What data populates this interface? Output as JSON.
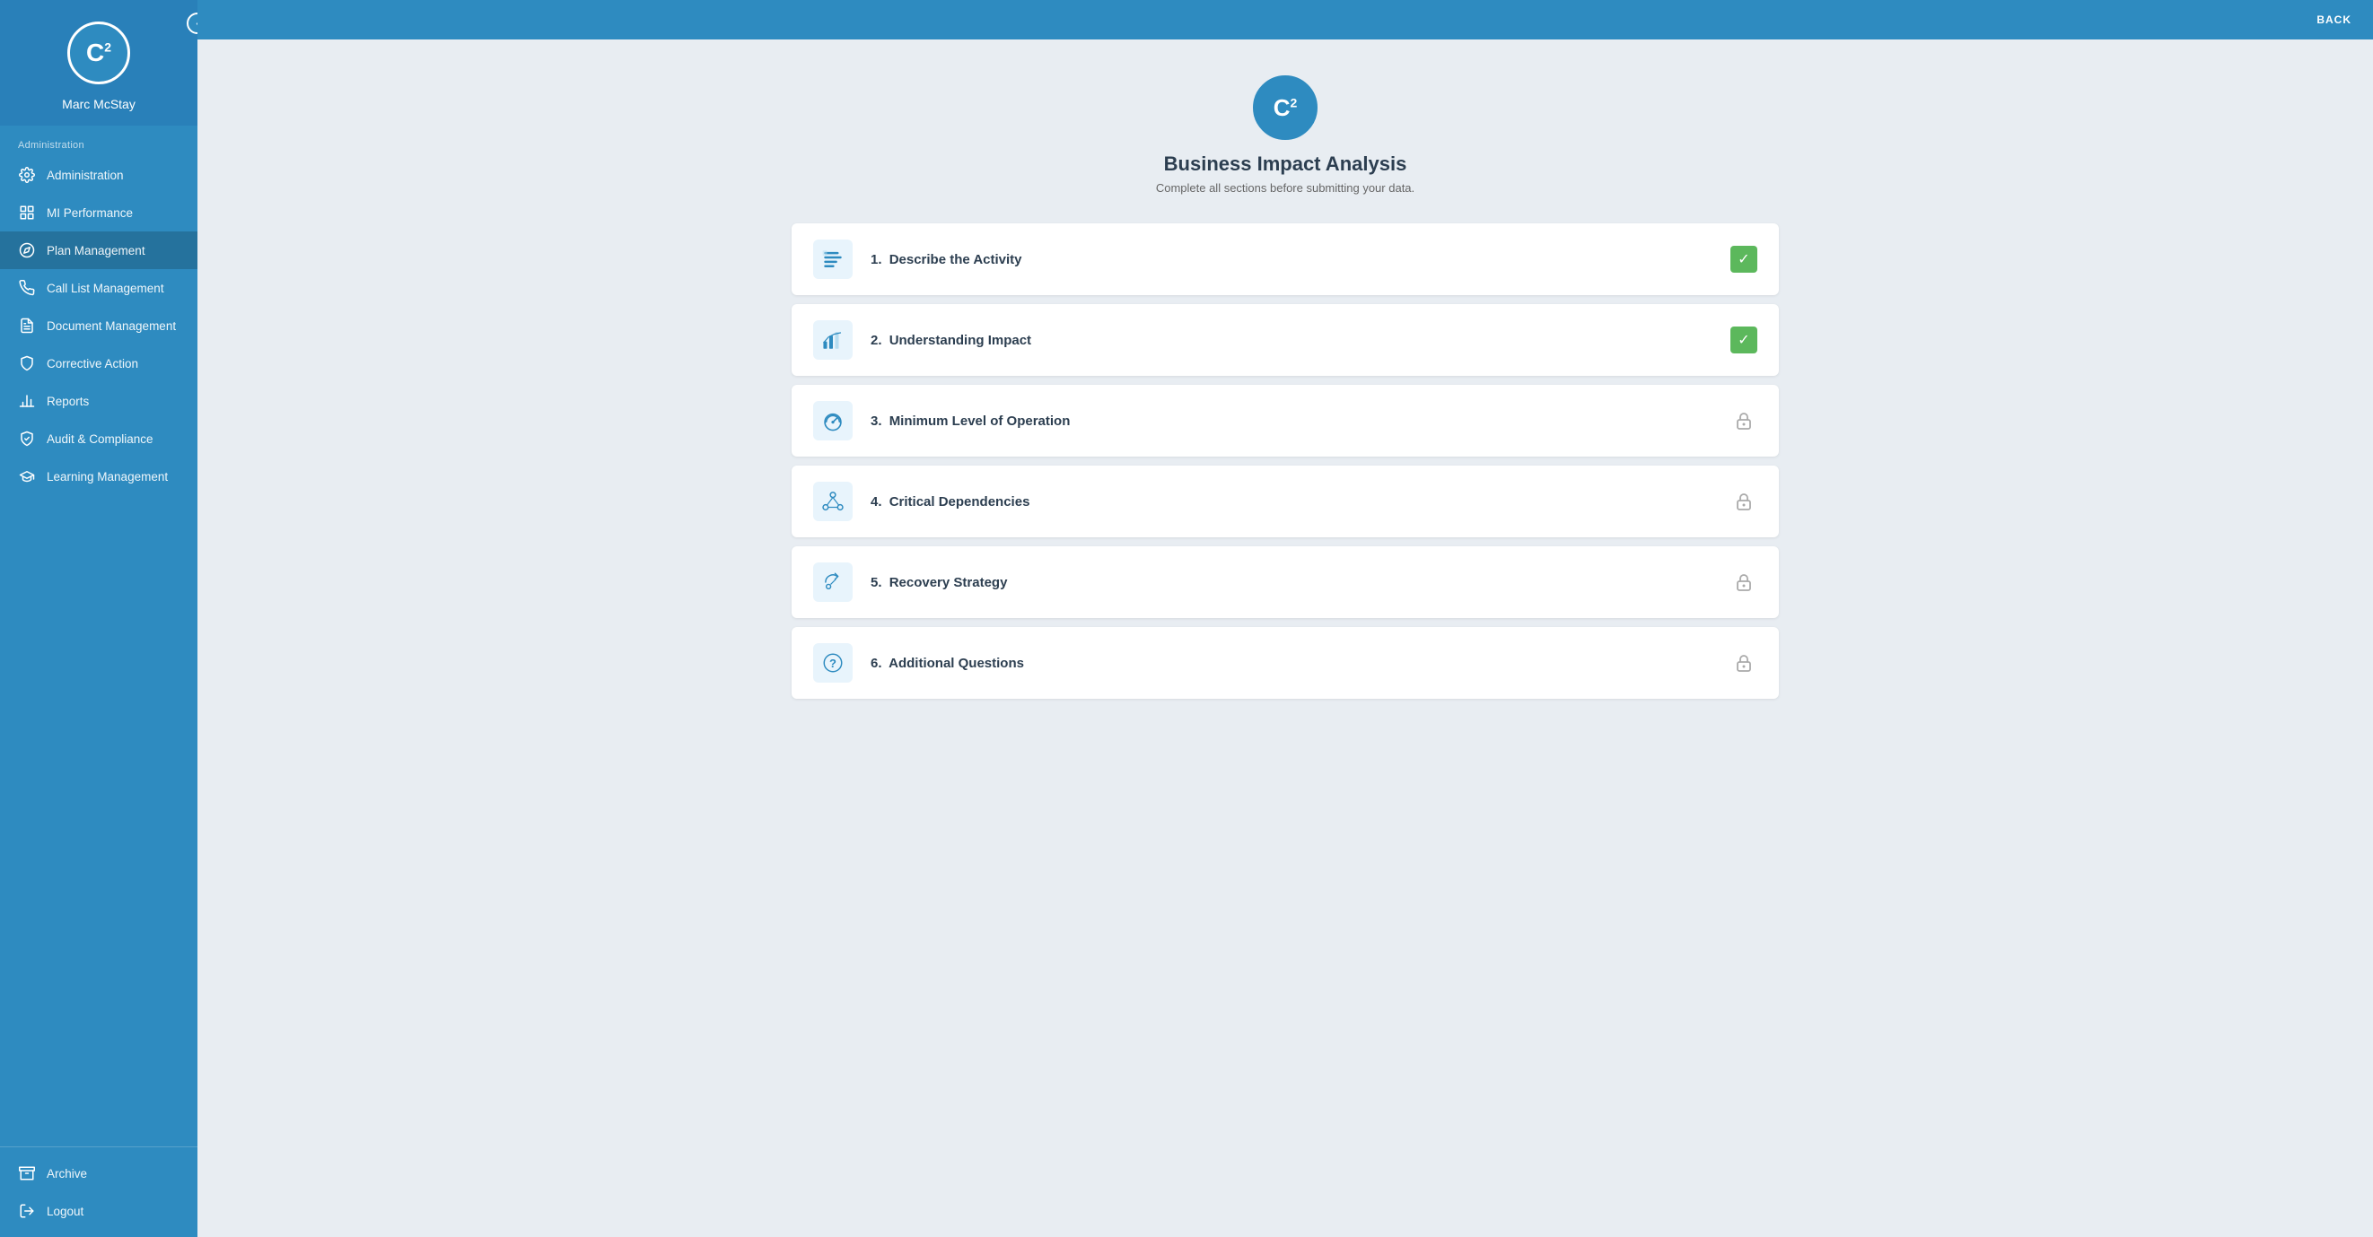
{
  "sidebar": {
    "logo_text": "C",
    "logo_sup": "2",
    "user_name": "Marc McStay",
    "collapse_icon": "‹",
    "section_label": "Administration",
    "items": [
      {
        "id": "administration",
        "label": "Administration",
        "icon": "gear"
      },
      {
        "id": "mi-performance",
        "label": "MI Performance",
        "icon": "dashboard"
      },
      {
        "id": "plan-management",
        "label": "Plan Management",
        "icon": "compass",
        "active": true
      },
      {
        "id": "call-list-management",
        "label": "Call List Management",
        "icon": "phone"
      },
      {
        "id": "document-management",
        "label": "Document Management",
        "icon": "document"
      },
      {
        "id": "corrective-action",
        "label": "Corrective Action",
        "icon": "shield"
      },
      {
        "id": "reports",
        "label": "Reports",
        "icon": "bar-chart"
      },
      {
        "id": "audit-compliance",
        "label": "Audit & Compliance",
        "icon": "check-shield"
      },
      {
        "id": "learning-management",
        "label": "Learning Management",
        "icon": "graduation"
      }
    ],
    "bottom_items": [
      {
        "id": "archive",
        "label": "Archive",
        "icon": "archive"
      },
      {
        "id": "logout",
        "label": "Logout",
        "icon": "logout"
      }
    ]
  },
  "topbar": {
    "back_label": "BACK"
  },
  "main": {
    "logo_text": "C",
    "logo_sup": "2",
    "title": "Business Impact Analysis",
    "subtitle": "Complete all sections before submitting your data.",
    "sections": [
      {
        "id": "describe-activity",
        "number": "1.",
        "label": "Describe the Activity",
        "icon": "text-icon",
        "status": "complete"
      },
      {
        "id": "understanding-impact",
        "number": "2.",
        "label": "Understanding Impact",
        "icon": "chart-icon",
        "status": "complete"
      },
      {
        "id": "minimum-level",
        "number": "3.",
        "label": "Minimum Level of Operation",
        "icon": "gauge-icon",
        "status": "locked"
      },
      {
        "id": "critical-dependencies",
        "number": "4.",
        "label": "Critical Dependencies",
        "icon": "network-icon",
        "status": "locked"
      },
      {
        "id": "recovery-strategy",
        "number": "5.",
        "label": "Recovery Strategy",
        "icon": "recovery-icon",
        "status": "locked"
      },
      {
        "id": "additional-questions",
        "number": "6.",
        "label": "Additional Questions",
        "icon": "question-icon",
        "status": "locked"
      }
    ]
  }
}
